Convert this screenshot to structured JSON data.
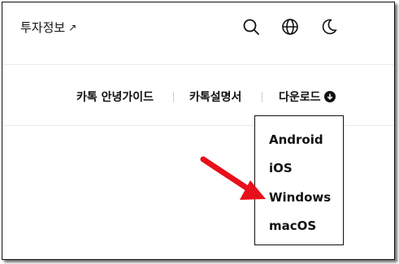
{
  "header": {
    "invest_link": "투자정보",
    "invest_arrow": "↗",
    "icons": [
      "search-icon",
      "globe-icon",
      "moon-icon"
    ]
  },
  "nav": {
    "items": [
      {
        "label": "카톡 안녕가이드"
      },
      {
        "label": "카톡설명서"
      },
      {
        "label": "다운로드",
        "icon": "download-circle-icon"
      }
    ]
  },
  "dropdown": {
    "items": [
      "Android",
      "iOS",
      "Windows",
      "macOS"
    ],
    "highlighted": "Windows"
  },
  "colors": {
    "text": "#111111",
    "divider": "#e9e9e9",
    "annotation_arrow": "#e8101a"
  }
}
